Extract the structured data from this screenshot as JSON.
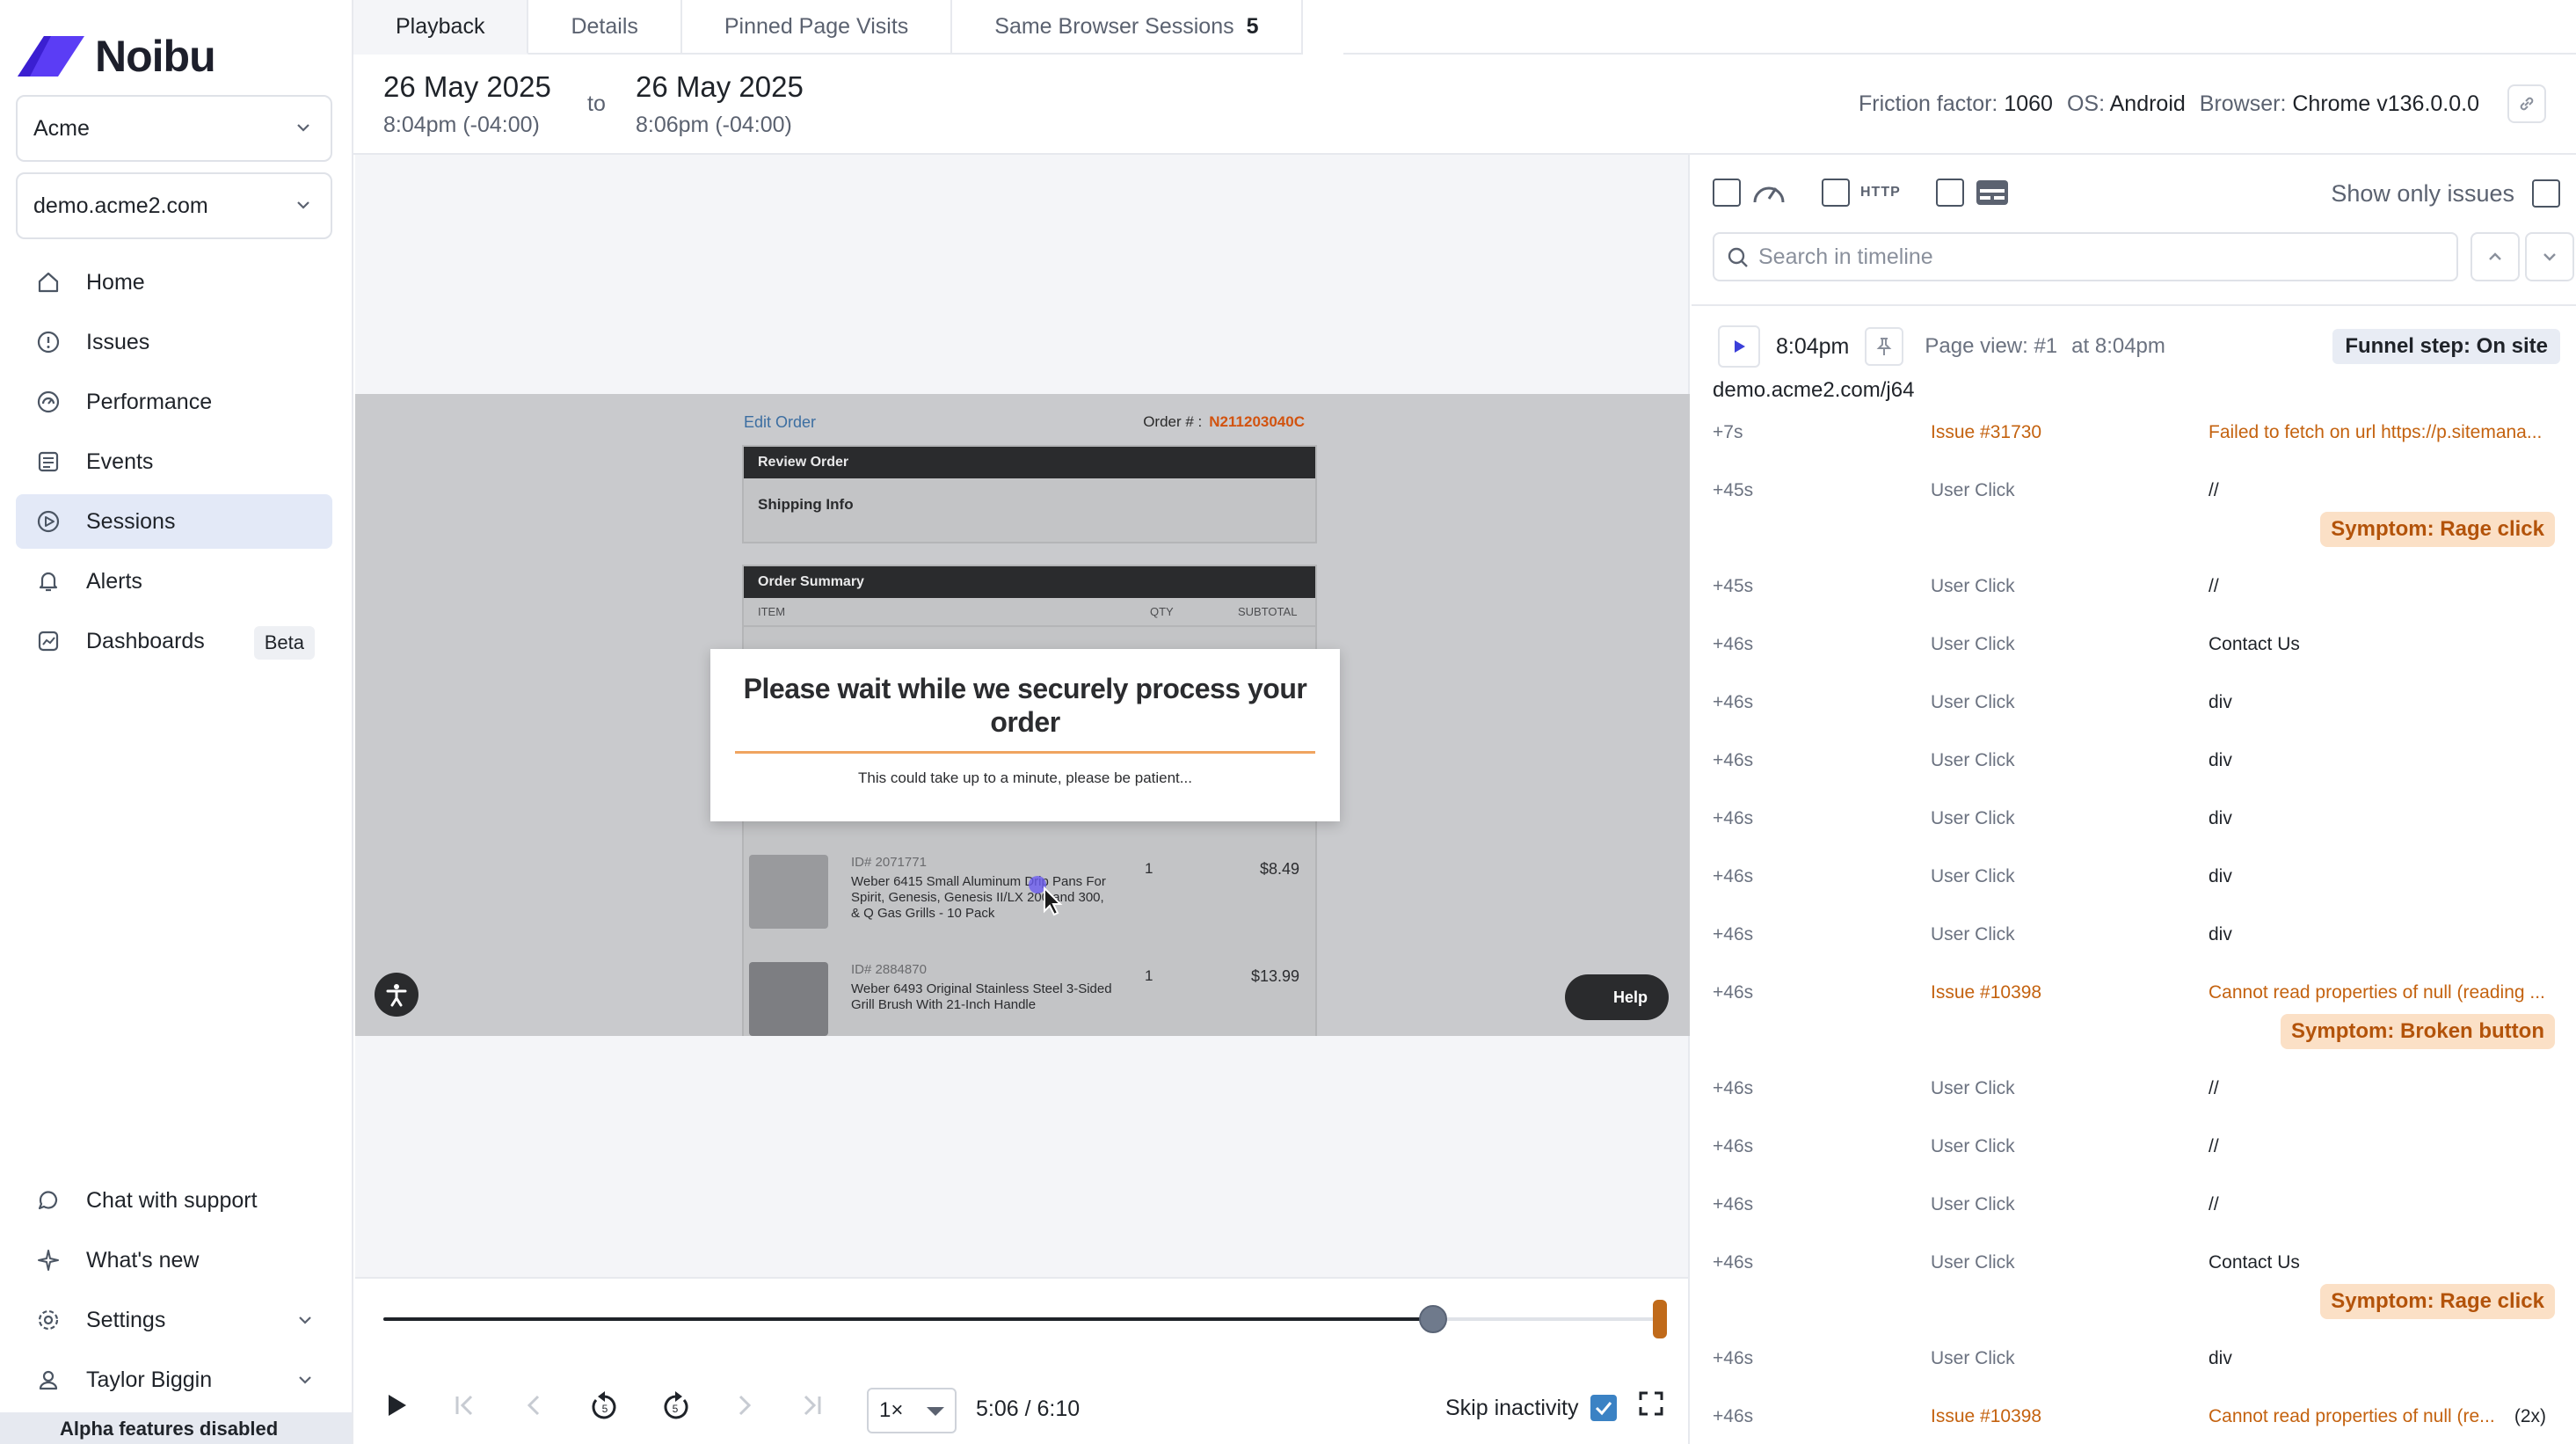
{
  "brand": {
    "name": "Noibu",
    "accent": "#5b3df5"
  },
  "sidebar": {
    "org": "Acme",
    "domain": "demo.acme2.com",
    "items": [
      {
        "label": "Home",
        "icon": "home-icon"
      },
      {
        "label": "Issues",
        "icon": "issues-icon"
      },
      {
        "label": "Performance",
        "icon": "performance-icon"
      },
      {
        "label": "Events",
        "icon": "events-icon"
      },
      {
        "label": "Sessions",
        "icon": "sessions-icon",
        "active": true
      },
      {
        "label": "Alerts",
        "icon": "bell-icon"
      },
      {
        "label": "Dashboards",
        "icon": "dashboards-icon",
        "badge": "Beta"
      }
    ],
    "bottom": [
      {
        "label": "Chat with support",
        "icon": "chat-icon"
      },
      {
        "label": "What's new",
        "icon": "sparkle-icon"
      },
      {
        "label": "Settings",
        "icon": "gear-icon"
      },
      {
        "label": "Taylor Biggin",
        "icon": "user-icon"
      }
    ],
    "alpha_note": "Alpha features disabled"
  },
  "tabs": [
    {
      "label": "Playback",
      "active": true
    },
    {
      "label": "Details"
    },
    {
      "label": "Pinned Page Visits"
    },
    {
      "label": "Same Browser Sessions",
      "count": "5"
    }
  ],
  "header": {
    "start_date": "26 May 2025",
    "start_time": "8:04pm (-04:00)",
    "to": "to",
    "end_date": "26 May 2025",
    "end_time": "8:06pm (-04:00)",
    "friction_label": "Friction factor:",
    "friction_value": "1060",
    "os_label": "OS:",
    "os_value": "Android",
    "browser_label": "Browser:",
    "browser_value": "Chrome v136.0.0.0"
  },
  "replay": {
    "edit_order": "Edit Order",
    "order_label": "Order # :",
    "order_no": "N211203040C",
    "review_order": "Review Order",
    "shipping_info": "Shipping Info",
    "order_summary": "Order Summary",
    "col_item": "ITEM",
    "col_qty": "QTY",
    "col_subtotal": "SUBTOTAL",
    "modal_title": "Please wait while we securely process your order",
    "modal_sub": "This could take up to a minute, please be patient...",
    "items": [
      {
        "id": "ID# 2071771",
        "desc": "Weber 6415 Small Aluminum Drip Pans For Spirit, Genesis, Genesis II/LX 200 and 300, & Q Gas Grills - 10 Pack",
        "qty": "1",
        "price": "$8.49"
      },
      {
        "id": "ID# 2884870",
        "desc": "Weber 6493 Original Stainless Steel 3-Sided Grill Brush With 21-Inch Handle",
        "qty": "1",
        "price": "$13.99"
      }
    ],
    "help": "Help"
  },
  "controls": {
    "speed": "1×",
    "time": "5:06 / 6:10",
    "progress": 0.82,
    "skip_label": "Skip inactivity",
    "skip_checked": true
  },
  "timeline": {
    "http_label": "HTTP",
    "show_only": "Show only issues",
    "search_placeholder": "Search in timeline",
    "pv_time": "8:04pm",
    "pv_label": "Page view: #1",
    "pv_at": "at 8:04pm",
    "funnel": "Funnel step: On site",
    "url": "demo.acme2.com/j64",
    "events": [
      {
        "off": "+7s",
        "type": "Issue #31730",
        "detail": "Failed to fetch on url https://p.sitemana...",
        "issue": true
      },
      {
        "off": "+45s",
        "type": "User Click",
        "detail": "//",
        "symptom": "Symptom: Rage click"
      },
      {
        "off": "+45s",
        "type": "User Click",
        "detail": "//"
      },
      {
        "off": "+46s",
        "type": "User Click",
        "detail": "Contact Us"
      },
      {
        "off": "+46s",
        "type": "User Click",
        "detail": "div"
      },
      {
        "off": "+46s",
        "type": "User Click",
        "detail": "div"
      },
      {
        "off": "+46s",
        "type": "User Click",
        "detail": "div"
      },
      {
        "off": "+46s",
        "type": "User Click",
        "detail": "div"
      },
      {
        "off": "+46s",
        "type": "User Click",
        "detail": "div"
      },
      {
        "off": "+46s",
        "type": "Issue #10398",
        "detail": "Cannot read properties of null (reading ...",
        "issue": true,
        "symptom": "Symptom: Broken button"
      },
      {
        "off": "+46s",
        "type": "User Click",
        "detail": "//"
      },
      {
        "off": "+46s",
        "type": "User Click",
        "detail": "//"
      },
      {
        "off": "+46s",
        "type": "User Click",
        "detail": "//"
      },
      {
        "off": "+46s",
        "type": "User Click",
        "detail": "Contact Us",
        "symptom": "Symptom: Rage click"
      },
      {
        "off": "+46s",
        "type": "User Click",
        "detail": "div"
      },
      {
        "off": "+46s",
        "type": "Issue #10398",
        "detail": "Cannot read properties of null (re...",
        "issue": true,
        "repeat": "(2x)"
      }
    ]
  }
}
